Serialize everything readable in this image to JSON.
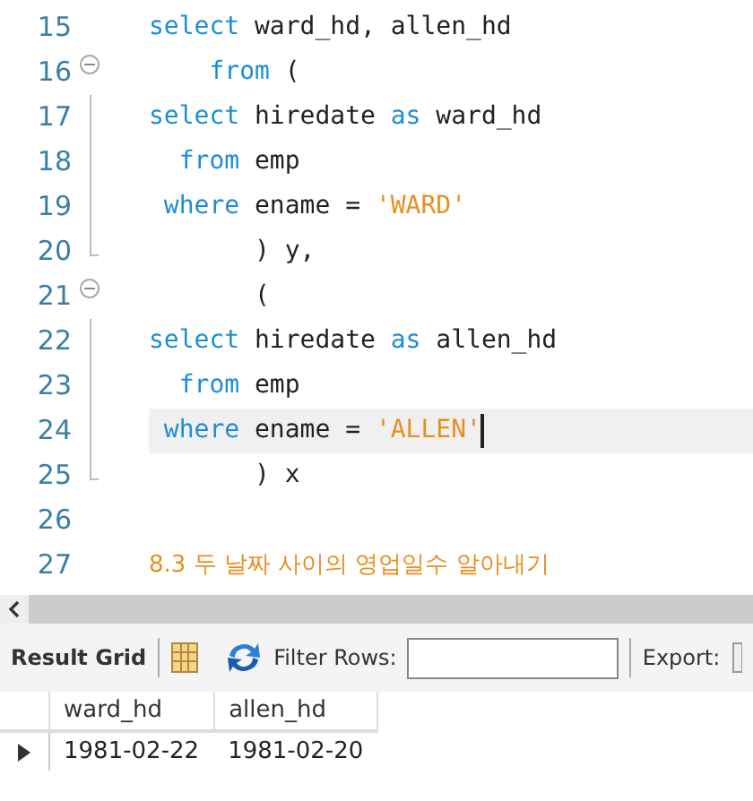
{
  "editor": {
    "lines": [
      {
        "number": "15",
        "fold_start": false,
        "fold_end": false,
        "current": false,
        "tokens": [
          {
            "kind": "kw",
            "text": "select"
          },
          {
            "kind": "id",
            "text": " ward_hd, allen_hd"
          }
        ]
      },
      {
        "number": "16",
        "fold_start": true,
        "fold_end": false,
        "current": false,
        "tokens": [
          {
            "kind": "kw",
            "text": "    from"
          },
          {
            "kind": "id",
            "text": " ("
          }
        ]
      },
      {
        "number": "17",
        "fold_start": false,
        "fold_end": false,
        "current": false,
        "tokens": [
          {
            "kind": "kw",
            "text": "select"
          },
          {
            "kind": "id",
            "text": " hiredate "
          },
          {
            "kind": "kw",
            "text": "as"
          },
          {
            "kind": "id",
            "text": " ward_hd"
          }
        ]
      },
      {
        "number": "18",
        "fold_start": false,
        "fold_end": false,
        "current": false,
        "tokens": [
          {
            "kind": "kw",
            "text": "  from"
          },
          {
            "kind": "id",
            "text": " emp"
          }
        ]
      },
      {
        "number": "19",
        "fold_start": false,
        "fold_end": false,
        "current": false,
        "tokens": [
          {
            "kind": "kw",
            "text": " where"
          },
          {
            "kind": "id",
            "text": " ename = "
          },
          {
            "kind": "str",
            "text": "'WARD'"
          }
        ]
      },
      {
        "number": "20",
        "fold_start": false,
        "fold_end": true,
        "current": false,
        "tokens": [
          {
            "kind": "id",
            "text": "       ) y,"
          }
        ]
      },
      {
        "number": "21",
        "fold_start": true,
        "fold_end": false,
        "current": false,
        "tokens": [
          {
            "kind": "id",
            "text": "       ("
          }
        ]
      },
      {
        "number": "22",
        "fold_start": false,
        "fold_end": false,
        "current": false,
        "tokens": [
          {
            "kind": "kw",
            "text": "select"
          },
          {
            "kind": "id",
            "text": " hiredate "
          },
          {
            "kind": "kw",
            "text": "as"
          },
          {
            "kind": "id",
            "text": " allen_hd"
          }
        ]
      },
      {
        "number": "23",
        "fold_start": false,
        "fold_end": false,
        "current": false,
        "tokens": [
          {
            "kind": "kw",
            "text": "  from"
          },
          {
            "kind": "id",
            "text": " emp"
          }
        ]
      },
      {
        "number": "24",
        "fold_start": false,
        "fold_end": false,
        "current": true,
        "tokens": [
          {
            "kind": "kw",
            "text": " where"
          },
          {
            "kind": "id",
            "text": " ename = "
          },
          {
            "kind": "str",
            "text": "'ALLEN'"
          }
        ]
      },
      {
        "number": "25",
        "fold_start": false,
        "fold_end": true,
        "current": false,
        "tokens": [
          {
            "kind": "id",
            "text": "       ) x"
          }
        ]
      },
      {
        "number": "26",
        "fold_start": false,
        "fold_end": false,
        "current": false
      },
      {
        "number": "27",
        "fold_start": false,
        "fold_end": false,
        "current": false,
        "tokens": [
          {
            "kind": "str",
            "text": "8.3 두 날짜 사이의 영업일수 알아내기"
          }
        ]
      }
    ]
  },
  "results": {
    "title": "Result Grid",
    "filter_label": "Filter Rows:",
    "export_label": "Export:",
    "columns": [
      "ward_hd",
      "allen_hd"
    ],
    "rows": [
      {
        "current": true,
        "cells": [
          "1981-02-22",
          "1981-02-20"
        ]
      }
    ]
  }
}
